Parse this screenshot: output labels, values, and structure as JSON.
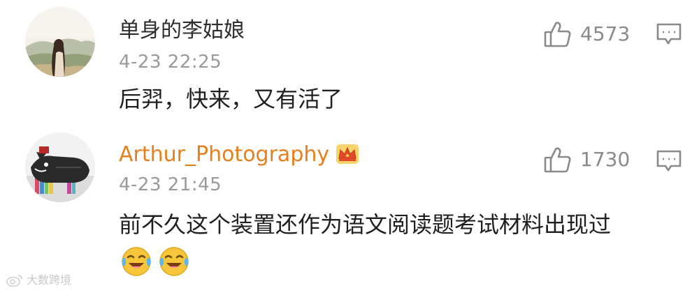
{
  "comments": [
    {
      "username": "单身的李姑娘",
      "timestamp": "4-23 22:25",
      "likes": "4573",
      "text": "后羿，快来，又有活了",
      "avatar_icon": "landscape-avatar-icon",
      "username_color": "#2d2d2d"
    },
    {
      "username": "Arthur_Photography",
      "timestamp": "4-23 21:45",
      "likes": "1730",
      "text": "前不久这个装置还作为语文阅读题考试材料出现过",
      "avatar_icon": "cat-avatar-icon",
      "badge_icon": "crown-icon",
      "username_color": "#e87f1d",
      "emojis": [
        "laugh-cry-emoji",
        "laugh-cry-emoji"
      ]
    }
  ],
  "watermark": {
    "text": "大数跨境",
    "icon": "weibo-logo-icon"
  },
  "colors": {
    "meta_gray": "#9a9a9a",
    "icon_gray": "#8a8a8a",
    "vip_orange": "#e87f1d"
  }
}
